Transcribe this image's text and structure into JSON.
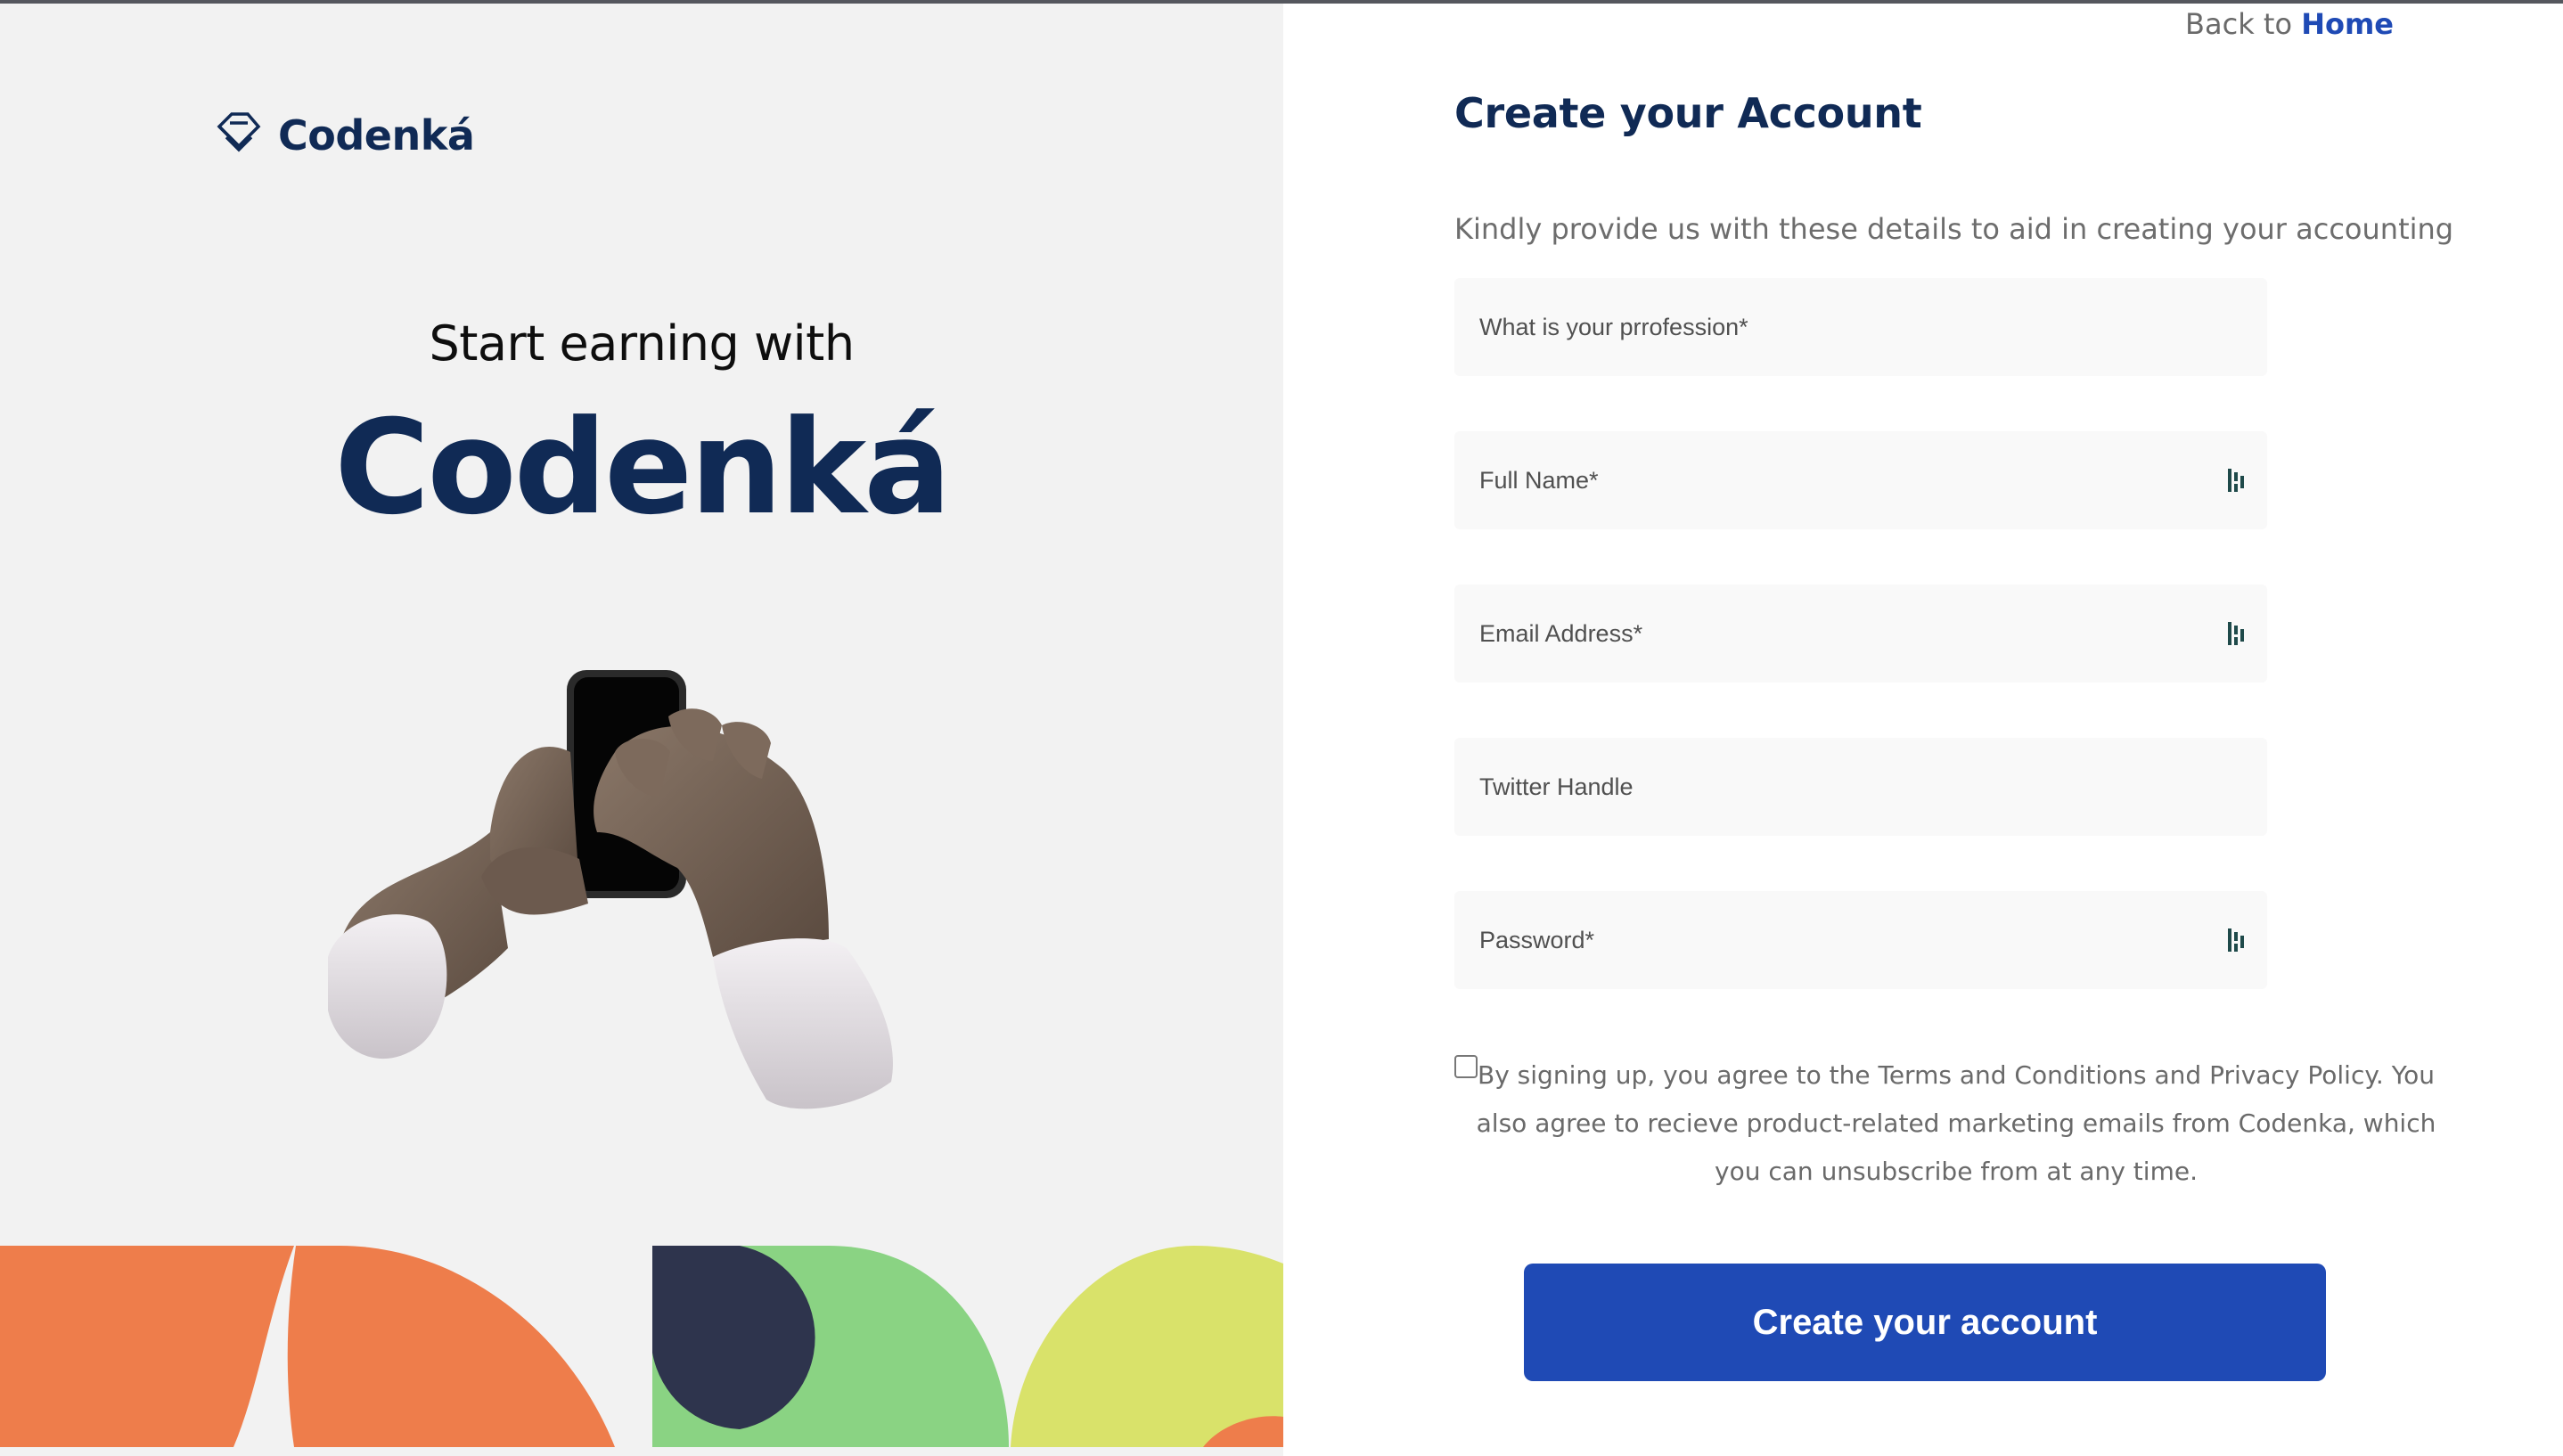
{
  "brand": {
    "name": "Codenká",
    "logo_icon": "codenka-diamond-icon"
  },
  "hero": {
    "tagline": "Start earning with",
    "title": "Codenká"
  },
  "nav": {
    "back_text": "Back to",
    "home_link": "Home"
  },
  "form": {
    "title": "Create your Account",
    "subtitle": "Kindly provide us with these details to aid in creating your accounting",
    "fields": [
      {
        "placeholder": "What is your prrofession*",
        "value": ""
      },
      {
        "placeholder": "Full Name*",
        "value": "",
        "autofill_icon": "autofill-icon"
      },
      {
        "placeholder": "Email Address*",
        "value": "",
        "autofill_icon": "autofill-icon"
      },
      {
        "placeholder": "Twitter Handle",
        "value": ""
      },
      {
        "placeholder": "Password*",
        "value": "",
        "autofill_icon": "autofill-icon"
      }
    ],
    "consent_text": "By signing up, you agree to the Terms and Conditions and Privacy Policy. You also agree to recieve product-related marketing emails from Codenka, which you can unsubscribe from at any time.",
    "consent_checked": false,
    "submit_label": "Create your account"
  },
  "colors": {
    "navy": "#102a55",
    "primary_blue": "#1f4ab5",
    "orange": "#ee7d4b",
    "green": "#8ad383",
    "lime": "#d9e26a",
    "dark_navy": "#2e344d",
    "left_bg": "#f2f2f2"
  }
}
